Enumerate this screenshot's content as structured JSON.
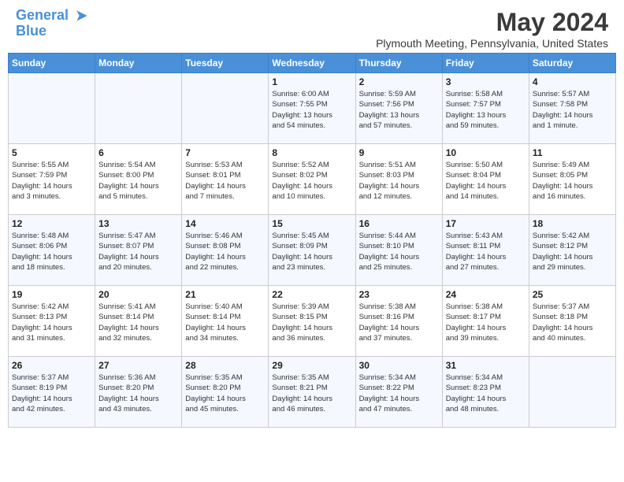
{
  "header": {
    "logo_line1": "General",
    "logo_line2": "Blue",
    "month": "May 2024",
    "location": "Plymouth Meeting, Pennsylvania, United States"
  },
  "weekdays": [
    "Sunday",
    "Monday",
    "Tuesday",
    "Wednesday",
    "Thursday",
    "Friday",
    "Saturday"
  ],
  "weeks": [
    [
      {
        "day": "",
        "content": ""
      },
      {
        "day": "",
        "content": ""
      },
      {
        "day": "",
        "content": ""
      },
      {
        "day": "1",
        "content": "Sunrise: 6:00 AM\nSunset: 7:55 PM\nDaylight: 13 hours\nand 54 minutes."
      },
      {
        "day": "2",
        "content": "Sunrise: 5:59 AM\nSunset: 7:56 PM\nDaylight: 13 hours\nand 57 minutes."
      },
      {
        "day": "3",
        "content": "Sunrise: 5:58 AM\nSunset: 7:57 PM\nDaylight: 13 hours\nand 59 minutes."
      },
      {
        "day": "4",
        "content": "Sunrise: 5:57 AM\nSunset: 7:58 PM\nDaylight: 14 hours\nand 1 minute."
      }
    ],
    [
      {
        "day": "5",
        "content": "Sunrise: 5:55 AM\nSunset: 7:59 PM\nDaylight: 14 hours\nand 3 minutes."
      },
      {
        "day": "6",
        "content": "Sunrise: 5:54 AM\nSunset: 8:00 PM\nDaylight: 14 hours\nand 5 minutes."
      },
      {
        "day": "7",
        "content": "Sunrise: 5:53 AM\nSunset: 8:01 PM\nDaylight: 14 hours\nand 7 minutes."
      },
      {
        "day": "8",
        "content": "Sunrise: 5:52 AM\nSunset: 8:02 PM\nDaylight: 14 hours\nand 10 minutes."
      },
      {
        "day": "9",
        "content": "Sunrise: 5:51 AM\nSunset: 8:03 PM\nDaylight: 14 hours\nand 12 minutes."
      },
      {
        "day": "10",
        "content": "Sunrise: 5:50 AM\nSunset: 8:04 PM\nDaylight: 14 hours\nand 14 minutes."
      },
      {
        "day": "11",
        "content": "Sunrise: 5:49 AM\nSunset: 8:05 PM\nDaylight: 14 hours\nand 16 minutes."
      }
    ],
    [
      {
        "day": "12",
        "content": "Sunrise: 5:48 AM\nSunset: 8:06 PM\nDaylight: 14 hours\nand 18 minutes."
      },
      {
        "day": "13",
        "content": "Sunrise: 5:47 AM\nSunset: 8:07 PM\nDaylight: 14 hours\nand 20 minutes."
      },
      {
        "day": "14",
        "content": "Sunrise: 5:46 AM\nSunset: 8:08 PM\nDaylight: 14 hours\nand 22 minutes."
      },
      {
        "day": "15",
        "content": "Sunrise: 5:45 AM\nSunset: 8:09 PM\nDaylight: 14 hours\nand 23 minutes."
      },
      {
        "day": "16",
        "content": "Sunrise: 5:44 AM\nSunset: 8:10 PM\nDaylight: 14 hours\nand 25 minutes."
      },
      {
        "day": "17",
        "content": "Sunrise: 5:43 AM\nSunset: 8:11 PM\nDaylight: 14 hours\nand 27 minutes."
      },
      {
        "day": "18",
        "content": "Sunrise: 5:42 AM\nSunset: 8:12 PM\nDaylight: 14 hours\nand 29 minutes."
      }
    ],
    [
      {
        "day": "19",
        "content": "Sunrise: 5:42 AM\nSunset: 8:13 PM\nDaylight: 14 hours\nand 31 minutes."
      },
      {
        "day": "20",
        "content": "Sunrise: 5:41 AM\nSunset: 8:14 PM\nDaylight: 14 hours\nand 32 minutes."
      },
      {
        "day": "21",
        "content": "Sunrise: 5:40 AM\nSunset: 8:14 PM\nDaylight: 14 hours\nand 34 minutes."
      },
      {
        "day": "22",
        "content": "Sunrise: 5:39 AM\nSunset: 8:15 PM\nDaylight: 14 hours\nand 36 minutes."
      },
      {
        "day": "23",
        "content": "Sunrise: 5:38 AM\nSunset: 8:16 PM\nDaylight: 14 hours\nand 37 minutes."
      },
      {
        "day": "24",
        "content": "Sunrise: 5:38 AM\nSunset: 8:17 PM\nDaylight: 14 hours\nand 39 minutes."
      },
      {
        "day": "25",
        "content": "Sunrise: 5:37 AM\nSunset: 8:18 PM\nDaylight: 14 hours\nand 40 minutes."
      }
    ],
    [
      {
        "day": "26",
        "content": "Sunrise: 5:37 AM\nSunset: 8:19 PM\nDaylight: 14 hours\nand 42 minutes."
      },
      {
        "day": "27",
        "content": "Sunrise: 5:36 AM\nSunset: 8:20 PM\nDaylight: 14 hours\nand 43 minutes."
      },
      {
        "day": "28",
        "content": "Sunrise: 5:35 AM\nSunset: 8:20 PM\nDaylight: 14 hours\nand 45 minutes."
      },
      {
        "day": "29",
        "content": "Sunrise: 5:35 AM\nSunset: 8:21 PM\nDaylight: 14 hours\nand 46 minutes."
      },
      {
        "day": "30",
        "content": "Sunrise: 5:34 AM\nSunset: 8:22 PM\nDaylight: 14 hours\nand 47 minutes."
      },
      {
        "day": "31",
        "content": "Sunrise: 5:34 AM\nSunset: 8:23 PM\nDaylight: 14 hours\nand 48 minutes."
      },
      {
        "day": "",
        "content": ""
      }
    ]
  ]
}
